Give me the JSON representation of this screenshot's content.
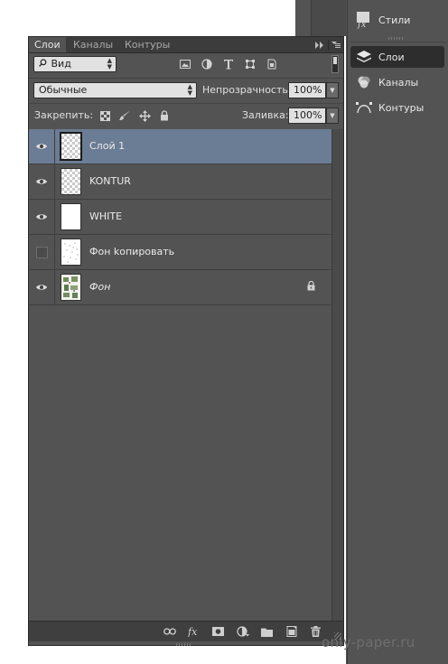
{
  "dock": {
    "items": [
      {
        "label": "Стили",
        "icon": "styles-fx-icon"
      },
      {
        "label": "Слои",
        "icon": "layers-icon",
        "active": true
      },
      {
        "label": "Каналы",
        "icon": "channels-icon"
      },
      {
        "label": "Контуры",
        "icon": "paths-icon"
      }
    ]
  },
  "panel": {
    "tabs": [
      {
        "label": "Слои",
        "active": true
      },
      {
        "label": "Каналы"
      },
      {
        "label": "Контуры"
      }
    ],
    "filter": {
      "label": "Вид"
    },
    "filter_icons": [
      "image-filter-icon",
      "adjustment-filter-icon",
      "type-filter-icon",
      "shape-filter-icon",
      "smart-object-filter-icon"
    ],
    "blend_mode": "Обычные",
    "opacity_label": "Непрозрачность:",
    "opacity_value": "100%",
    "lock_label": "Закрепить:",
    "lock_icons": [
      "lock-transparent-icon",
      "lock-paint-icon",
      "lock-move-icon",
      "lock-all-icon"
    ],
    "fill_label": "Заливка:",
    "fill_value": "100%"
  },
  "layers": [
    {
      "name": "Слой 1",
      "visible": true,
      "selected": true,
      "thumb": "checker"
    },
    {
      "name": "KONTUR",
      "visible": true,
      "thumb": "checker"
    },
    {
      "name": "WHITE",
      "visible": true,
      "thumb": "white"
    },
    {
      "name": "Фон kопировать",
      "visible": false,
      "thumb": "sketch"
    },
    {
      "name": "Фон",
      "visible": true,
      "thumb": "photo",
      "italic": true,
      "locked": true
    }
  ],
  "bottom_icons": [
    "link-layers-icon",
    "fx-icon",
    "add-mask-icon",
    "new-adjustment-icon",
    "new-group-icon",
    "new-layer-icon",
    "delete-layer-icon"
  ],
  "watermark": "only-paper.ru",
  "colors": {
    "panel_bg": "#535353",
    "selected_layer": "#6b7c95",
    "tab_bar": "#3c3c3c"
  }
}
